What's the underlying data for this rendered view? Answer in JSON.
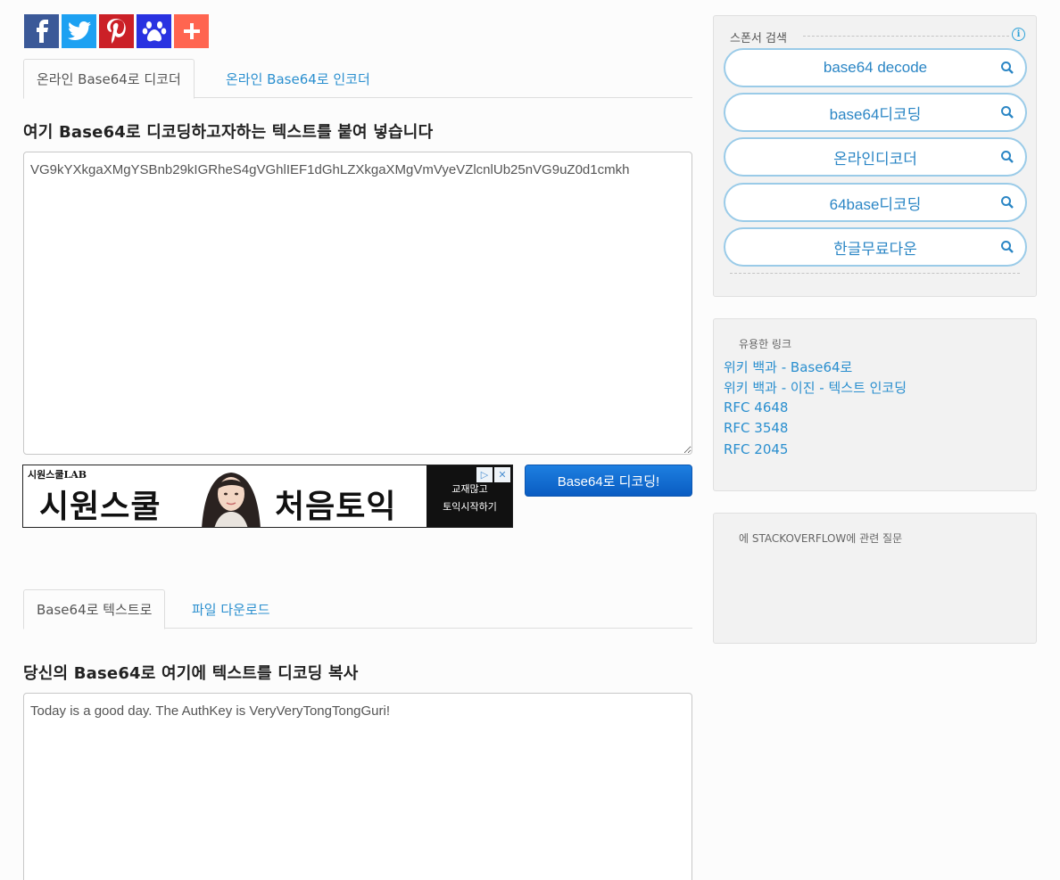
{
  "share": {
    "items": [
      {
        "icon": "facebook-icon",
        "color": "#3b5998",
        "glyph": "f"
      },
      {
        "icon": "twitter-icon",
        "color": "#1da1f2",
        "glyph": "t"
      },
      {
        "icon": "pinterest-icon",
        "color": "#cb2027",
        "glyph": "p"
      },
      {
        "icon": "paw-icon",
        "color": "#2932e1",
        "glyph": "paw"
      },
      {
        "icon": "plus-icon",
        "color": "#ff6550",
        "glyph": "+"
      }
    ]
  },
  "top_tabs": {
    "decoder": "온라인 Base64로 디코더",
    "encoder": "온라인 Base64로 인코더"
  },
  "input_section": {
    "heading": "여기 Base64로 디코딩하고자하는 텍스트를 붙여 넣습니다",
    "value": "VG9kYXkgaXMgYSBnb29kIGRheS4gVGhlIEF1dGhLZXkgaXMgVmVyeVZlcnlUb25nVG9uZ0d1cmkh"
  },
  "ad": {
    "brand": "시원스쿨LAB",
    "text1": "시원스쿨",
    "text2": "처음토익",
    "cta_line1": "교재많고",
    "cta_line2": "토익시작하기"
  },
  "decode_button": "Base64로 디코딩!",
  "bottom_tabs": {
    "to_text": "Base64로 텍스트로",
    "download": "파일 다운로드"
  },
  "output_section": {
    "heading": "당신의 Base64로 여기에 텍스트를 디코딩 복사",
    "value": "Today is a good day. The AuthKey is VeryVeryTongTongGuri!"
  },
  "sponsor": {
    "title": "스폰서 검색",
    "buttons": [
      "base64 decode",
      "base64디코딩",
      "온라인디코더",
      "64base디코딩",
      "한글무료다운"
    ]
  },
  "useful_links": {
    "title": "유용한 링크",
    "links": [
      "위키 백과 - Base64로",
      "위키 백과 - 이진 - 텍스트 인코딩",
      "RFC 4648",
      "RFC 3548",
      "RFC 2045"
    ]
  },
  "stackoverflow": {
    "title": "에 STACKOVERFLOW에 관련 질문"
  },
  "colors": {
    "link": "#2a8fcf",
    "button_blue": "#0a5cc2",
    "panel_bg": "#f2f2f2"
  }
}
